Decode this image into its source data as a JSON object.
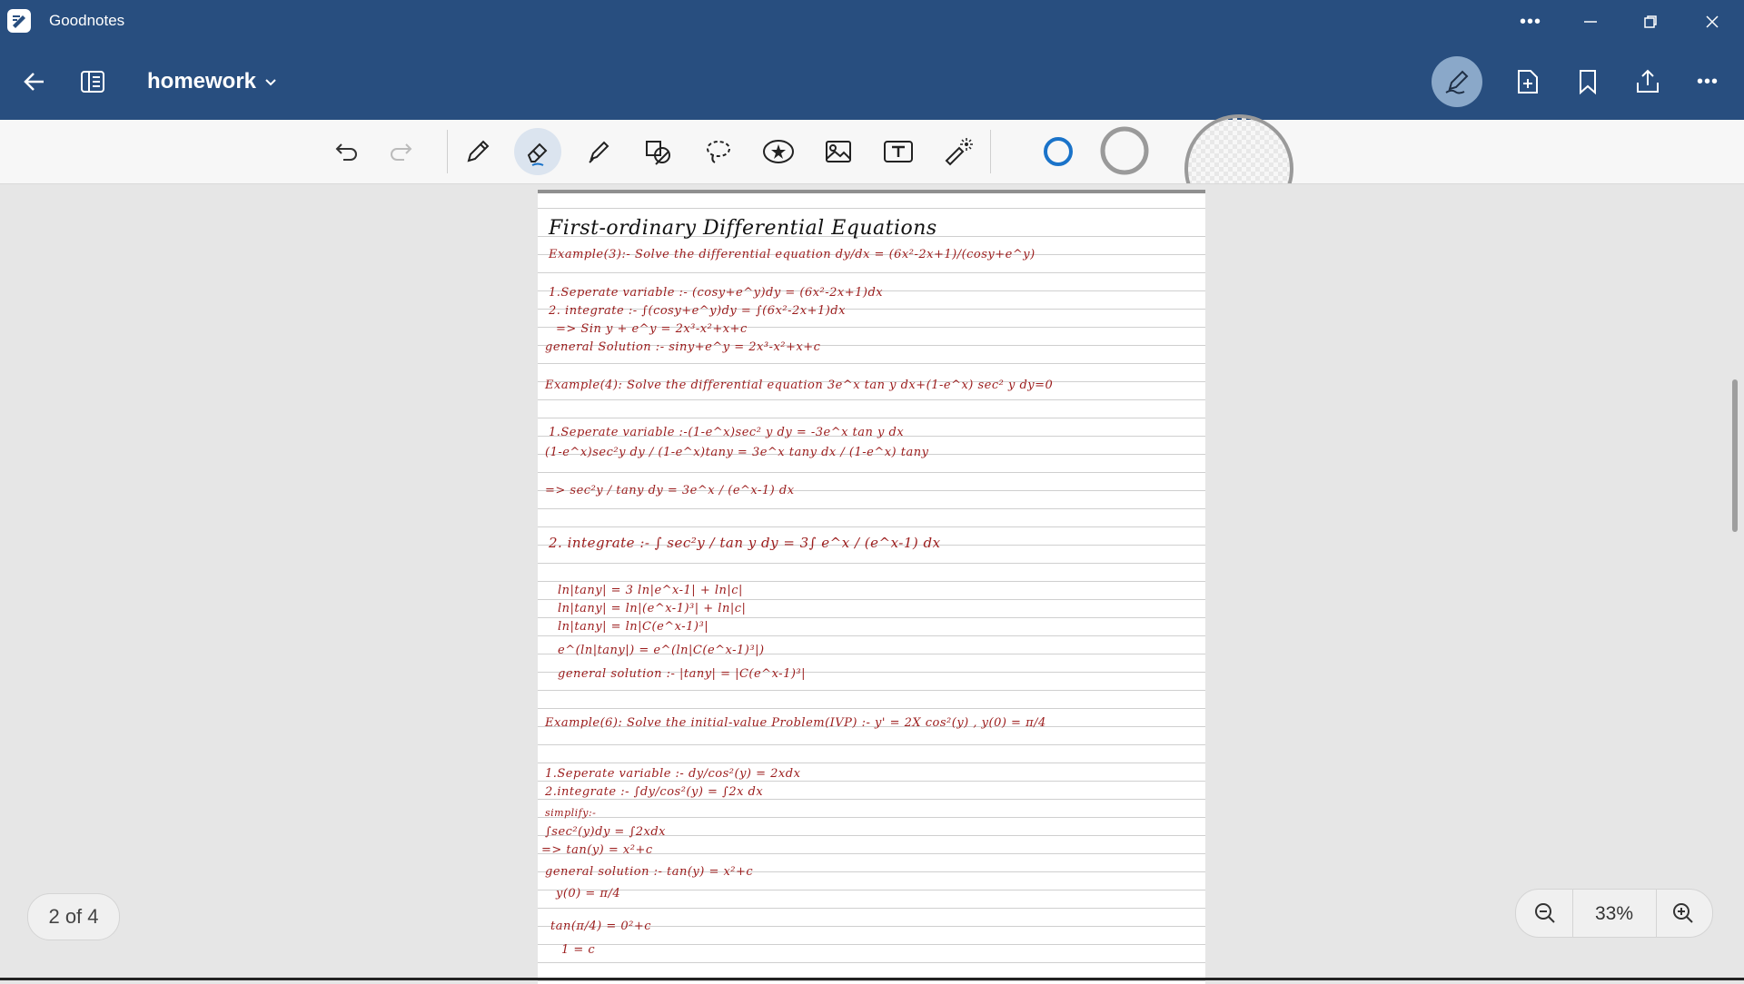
{
  "window": {
    "app_title": "Goodnotes"
  },
  "header": {
    "doc_title": "homework"
  },
  "toolbar": {
    "tools": [
      "undo-icon",
      "redo-icon",
      "pen-icon",
      "eraser-icon",
      "highlighter-icon",
      "shapes-icon",
      "lasso-icon",
      "elements-icon",
      "image-icon",
      "text-box-icon",
      "laser-pointer-icon"
    ],
    "active_tool": "eraser-icon",
    "colors": [
      "#1a73c9",
      "#9a9a9a"
    ]
  },
  "page_content": {
    "title": "First-ordinary Differential Equations",
    "lines": [
      "Example(3):- Solve the differential equation  dy/dx = (6x²-2x+1)/(cosy+e^y)",
      "1.Seperate variable :- (cosy+e^y)dy = (6x²-2x+1)dx",
      "2. integrate :- ∫(cosy+e^y)dy = ∫(6x²-2x+1)dx",
      "=> Sin y + e^y = 2x³-x²+x+c",
      "general Solution :- siny+e^y = 2x³-x²+x+c",
      "Example(4): Solve the differential equation 3e^x tan y dx+(1-e^x) sec² y dy=0",
      "1.Seperate variable :-(1-e^x)sec² y dy = -3e^x tan y dx",
      "(1-e^x)sec²y dy / (1-e^x)tany = 3e^x tany dx / (1-e^x) tany",
      "=> sec²y / tany dy = 3e^x / (e^x-1) dx",
      "2. integrate :- ∫ sec²y / tan y dy = 3∫ e^x / (e^x-1) dx",
      "ln|tany| = 3 ln|e^x-1| + ln|c|",
      "ln|tany| = ln|(e^x-1)³| + ln|c|",
      "ln|tany| = ln|C(e^x-1)³|",
      "e^(ln|tany|) = e^(ln|C(e^x-1)³|)",
      "general solution :- |tany| = |C(e^x-1)³|",
      "Example(6): Solve the initial-value Problem(IVP) :- y' = 2X cos²(y) , y(0) = π/4",
      "1.Seperate variable :- dy/cos²(y) = 2xdx",
      "2.integrate :- ∫dy/cos²(y) = ∫2x dx",
      "simplify:-",
      "∫sec²(y)dy = ∫2xdx",
      "=> tan(y) = x²+c",
      "general solution :- tan(y) = x²+c",
      "y(0) = π/4",
      "tan(π/4) = 0²+c",
      "1 = c"
    ]
  },
  "footer": {
    "page_indicator": "2 of 4",
    "zoom_level": "33%"
  }
}
